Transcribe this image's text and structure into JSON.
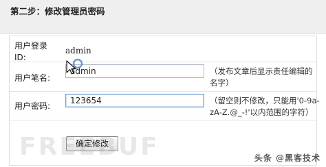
{
  "header": {
    "title": "第二步：修改管理员密码"
  },
  "form": {
    "username_label": "用户登录ID:",
    "username_value": "admin",
    "pen_name_label": "用户笔名:",
    "pen_name_value": "admin",
    "pen_name_hint": "（发布文章后显示责任编辑的名字）",
    "password_label": "用户密码:",
    "password_value": "123654",
    "password_hint": "（留空则不修改，只能用'0-9a-zA-Z.@_-!'以内范围的字符）",
    "submit_label": "确定修改"
  },
  "watermark": "FREEBUF",
  "credit": "头条 @黑客技术"
}
